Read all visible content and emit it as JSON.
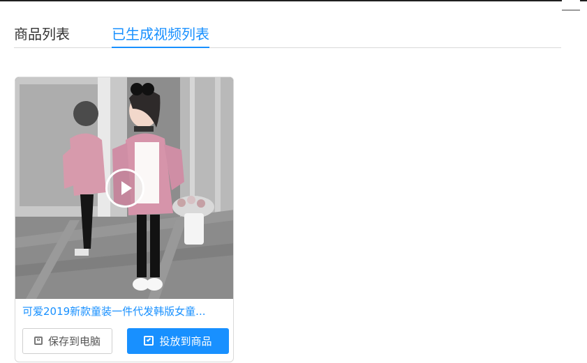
{
  "tabs": [
    {
      "label": "商品列表",
      "active": false
    },
    {
      "label": "已生成视频列表",
      "active": true
    }
  ],
  "video_card": {
    "title": "可爱2019新款童装一件代发韩版女童...",
    "buttons": {
      "save_label": "保存到电脑",
      "save_icon": "save-icon",
      "publish_label": "投放到商品",
      "publish_icon": "publish-icon"
    },
    "thumbnail_icon": "play-icon"
  },
  "colors": {
    "primary": "#1890ff",
    "border": "#d9d9d9",
    "text": "#333333"
  }
}
